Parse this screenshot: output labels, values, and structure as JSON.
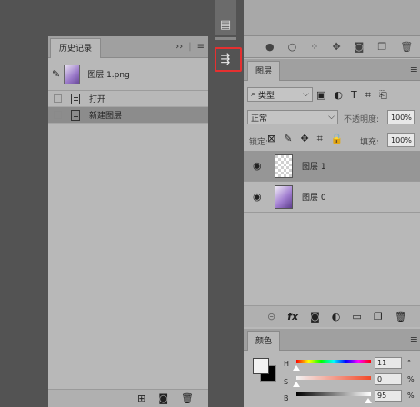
{
  "history": {
    "tab_label": "历史记录",
    "snapshot": {
      "label": "图层 1.png"
    },
    "items": [
      {
        "label": "打开"
      },
      {
        "label": "新建图层"
      }
    ]
  },
  "layers": {
    "tab_label": "图层",
    "filter_kind": "类型",
    "blend_mode": "正常",
    "opacity_label": "不透明度:",
    "opacity_value": "100%",
    "lock_label": "锁定:",
    "fill_label": "填充:",
    "fill_value": "100%",
    "items": [
      {
        "name": "图层 1"
      },
      {
        "name": "图层 0"
      }
    ]
  },
  "color": {
    "tab_label": "颜色",
    "h_label": "H",
    "h_value": "11",
    "h_unit": "°",
    "s_label": "S",
    "s_value": "0",
    "s_unit": "%",
    "b_label": "B",
    "b_value": "95",
    "b_unit": "%"
  },
  "colors": {
    "highlight": "#e53030"
  }
}
